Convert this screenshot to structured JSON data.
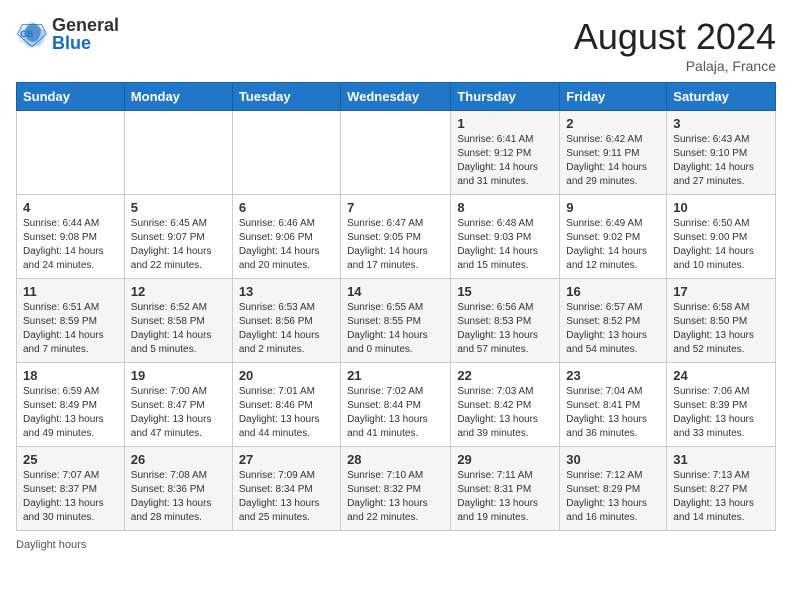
{
  "header": {
    "logo_general": "General",
    "logo_blue": "Blue",
    "month_year": "August 2024",
    "location": "Palaja, France"
  },
  "days_of_week": [
    "Sunday",
    "Monday",
    "Tuesday",
    "Wednesday",
    "Thursday",
    "Friday",
    "Saturday"
  ],
  "weeks": [
    [
      {
        "day": "",
        "info": ""
      },
      {
        "day": "",
        "info": ""
      },
      {
        "day": "",
        "info": ""
      },
      {
        "day": "",
        "info": ""
      },
      {
        "day": "1",
        "info": "Sunrise: 6:41 AM\nSunset: 9:12 PM\nDaylight: 14 hours\nand 31 minutes."
      },
      {
        "day": "2",
        "info": "Sunrise: 6:42 AM\nSunset: 9:11 PM\nDaylight: 14 hours\nand 29 minutes."
      },
      {
        "day": "3",
        "info": "Sunrise: 6:43 AM\nSunset: 9:10 PM\nDaylight: 14 hours\nand 27 minutes."
      }
    ],
    [
      {
        "day": "4",
        "info": "Sunrise: 6:44 AM\nSunset: 9:08 PM\nDaylight: 14 hours\nand 24 minutes."
      },
      {
        "day": "5",
        "info": "Sunrise: 6:45 AM\nSunset: 9:07 PM\nDaylight: 14 hours\nand 22 minutes."
      },
      {
        "day": "6",
        "info": "Sunrise: 6:46 AM\nSunset: 9:06 PM\nDaylight: 14 hours\nand 20 minutes."
      },
      {
        "day": "7",
        "info": "Sunrise: 6:47 AM\nSunset: 9:05 PM\nDaylight: 14 hours\nand 17 minutes."
      },
      {
        "day": "8",
        "info": "Sunrise: 6:48 AM\nSunset: 9:03 PM\nDaylight: 14 hours\nand 15 minutes."
      },
      {
        "day": "9",
        "info": "Sunrise: 6:49 AM\nSunset: 9:02 PM\nDaylight: 14 hours\nand 12 minutes."
      },
      {
        "day": "10",
        "info": "Sunrise: 6:50 AM\nSunset: 9:00 PM\nDaylight: 14 hours\nand 10 minutes."
      }
    ],
    [
      {
        "day": "11",
        "info": "Sunrise: 6:51 AM\nSunset: 8:59 PM\nDaylight: 14 hours\nand 7 minutes."
      },
      {
        "day": "12",
        "info": "Sunrise: 6:52 AM\nSunset: 8:58 PM\nDaylight: 14 hours\nand 5 minutes."
      },
      {
        "day": "13",
        "info": "Sunrise: 6:53 AM\nSunset: 8:56 PM\nDaylight: 14 hours\nand 2 minutes."
      },
      {
        "day": "14",
        "info": "Sunrise: 6:55 AM\nSunset: 8:55 PM\nDaylight: 14 hours\nand 0 minutes."
      },
      {
        "day": "15",
        "info": "Sunrise: 6:56 AM\nSunset: 8:53 PM\nDaylight: 13 hours\nand 57 minutes."
      },
      {
        "day": "16",
        "info": "Sunrise: 6:57 AM\nSunset: 8:52 PM\nDaylight: 13 hours\nand 54 minutes."
      },
      {
        "day": "17",
        "info": "Sunrise: 6:58 AM\nSunset: 8:50 PM\nDaylight: 13 hours\nand 52 minutes."
      }
    ],
    [
      {
        "day": "18",
        "info": "Sunrise: 6:59 AM\nSunset: 8:49 PM\nDaylight: 13 hours\nand 49 minutes."
      },
      {
        "day": "19",
        "info": "Sunrise: 7:00 AM\nSunset: 8:47 PM\nDaylight: 13 hours\nand 47 minutes."
      },
      {
        "day": "20",
        "info": "Sunrise: 7:01 AM\nSunset: 8:46 PM\nDaylight: 13 hours\nand 44 minutes."
      },
      {
        "day": "21",
        "info": "Sunrise: 7:02 AM\nSunset: 8:44 PM\nDaylight: 13 hours\nand 41 minutes."
      },
      {
        "day": "22",
        "info": "Sunrise: 7:03 AM\nSunset: 8:42 PM\nDaylight: 13 hours\nand 39 minutes."
      },
      {
        "day": "23",
        "info": "Sunrise: 7:04 AM\nSunset: 8:41 PM\nDaylight: 13 hours\nand 36 minutes."
      },
      {
        "day": "24",
        "info": "Sunrise: 7:06 AM\nSunset: 8:39 PM\nDaylight: 13 hours\nand 33 minutes."
      }
    ],
    [
      {
        "day": "25",
        "info": "Sunrise: 7:07 AM\nSunset: 8:37 PM\nDaylight: 13 hours\nand 30 minutes."
      },
      {
        "day": "26",
        "info": "Sunrise: 7:08 AM\nSunset: 8:36 PM\nDaylight: 13 hours\nand 28 minutes."
      },
      {
        "day": "27",
        "info": "Sunrise: 7:09 AM\nSunset: 8:34 PM\nDaylight: 13 hours\nand 25 minutes."
      },
      {
        "day": "28",
        "info": "Sunrise: 7:10 AM\nSunset: 8:32 PM\nDaylight: 13 hours\nand 22 minutes."
      },
      {
        "day": "29",
        "info": "Sunrise: 7:11 AM\nSunset: 8:31 PM\nDaylight: 13 hours\nand 19 minutes."
      },
      {
        "day": "30",
        "info": "Sunrise: 7:12 AM\nSunset: 8:29 PM\nDaylight: 13 hours\nand 16 minutes."
      },
      {
        "day": "31",
        "info": "Sunrise: 7:13 AM\nSunset: 8:27 PM\nDaylight: 13 hours\nand 14 minutes."
      }
    ]
  ],
  "footer": {
    "daylight_label": "Daylight hours"
  }
}
